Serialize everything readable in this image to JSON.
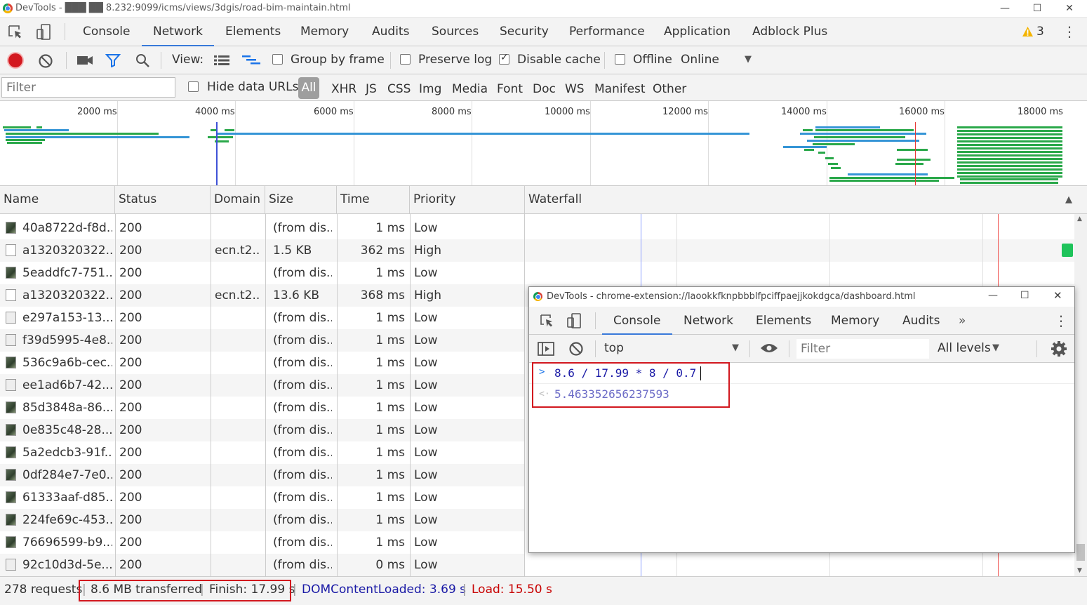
{
  "window": {
    "title": "DevTools - ███ ██ 8.232:9099/icms/views/3dgis/road-bim-maintain.html",
    "minimize": "—",
    "maximize": "☐",
    "close": "✕"
  },
  "tabs": [
    "Console",
    "Network",
    "Elements",
    "Memory",
    "Audits",
    "Sources",
    "Security",
    "Performance",
    "Application",
    "Adblock Plus"
  ],
  "warnings": "3",
  "more_glyph": "⋮",
  "toolbar": {
    "view_label": "View:",
    "group_by_frame": "Group by frame",
    "preserve_log": "Preserve log",
    "disable_cache": "Disable cache",
    "disable_cache_checked": true,
    "offline": "Offline",
    "throttling": "Online",
    "dropdown_glyph": "▼"
  },
  "filterbar": {
    "placeholder": "Filter",
    "hide_data_urls": "Hide data URLs",
    "types": [
      "All",
      "XHR",
      "JS",
      "CSS",
      "Img",
      "Media",
      "Font",
      "Doc",
      "WS",
      "Manifest",
      "Other"
    ]
  },
  "overview": {
    "ticks": [
      "2000 ms",
      "4000 ms",
      "6000 ms",
      "8000 ms",
      "10000 ms",
      "12000 ms",
      "14000 ms",
      "16000 ms",
      "18000 ms"
    ]
  },
  "columns": [
    "Name",
    "Status",
    "Domain",
    "Size",
    "Time",
    "Priority",
    "Waterfall"
  ],
  "sort_glyph": "▲",
  "rows": [
    {
      "name": "40a8722d-f8d...",
      "status": "200",
      "domain": "",
      "size": "(from dis...",
      "time": "1 ms",
      "priority": "Low",
      "icon": "img"
    },
    {
      "name": "a1320320322...",
      "status": "200",
      "domain": "ecn.t2...",
      "size": "1.5 KB",
      "time": "362 ms",
      "priority": "High",
      "icon": "blank"
    },
    {
      "name": "5eaddfc7-751...",
      "status": "200",
      "domain": "",
      "size": "(from dis...",
      "time": "1 ms",
      "priority": "Low",
      "icon": "img"
    },
    {
      "name": "a1320320322...",
      "status": "200",
      "domain": "ecn.t2...",
      "size": "13.6 KB",
      "time": "368 ms",
      "priority": "High",
      "icon": "blank"
    },
    {
      "name": "e297a153-13...",
      "status": "200",
      "domain": "",
      "size": "(from dis...",
      "time": "1 ms",
      "priority": "Low",
      "icon": "light"
    },
    {
      "name": "f39d5995-4e8...",
      "status": "200",
      "domain": "",
      "size": "(from dis...",
      "time": "1 ms",
      "priority": "Low",
      "icon": "light"
    },
    {
      "name": "536c9a6b-cec...",
      "status": "200",
      "domain": "",
      "size": "(from dis...",
      "time": "1 ms",
      "priority": "Low",
      "icon": "img"
    },
    {
      "name": "ee1ad6b7-42...",
      "status": "200",
      "domain": "",
      "size": "(from dis...",
      "time": "1 ms",
      "priority": "Low",
      "icon": "light"
    },
    {
      "name": "85d3848a-86...",
      "status": "200",
      "domain": "",
      "size": "(from dis...",
      "time": "1 ms",
      "priority": "Low",
      "icon": "img"
    },
    {
      "name": "0e835c48-28...",
      "status": "200",
      "domain": "",
      "size": "(from dis...",
      "time": "1 ms",
      "priority": "Low",
      "icon": "img"
    },
    {
      "name": "5a2edcb3-91f...",
      "status": "200",
      "domain": "",
      "size": "(from dis...",
      "time": "1 ms",
      "priority": "Low",
      "icon": "img"
    },
    {
      "name": "0df284e7-7e0...",
      "status": "200",
      "domain": "",
      "size": "(from dis...",
      "time": "1 ms",
      "priority": "Low",
      "icon": "img"
    },
    {
      "name": "61333aaf-d85...",
      "status": "200",
      "domain": "",
      "size": "(from dis...",
      "time": "1 ms",
      "priority": "Low",
      "icon": "img"
    },
    {
      "name": "224fe69c-453...",
      "status": "200",
      "domain": "",
      "size": "(from dis...",
      "time": "1 ms",
      "priority": "Low",
      "icon": "img"
    },
    {
      "name": "76696599-b9...",
      "status": "200",
      "domain": "",
      "size": "(from dis...",
      "time": "1 ms",
      "priority": "Low",
      "icon": "img"
    },
    {
      "name": "92c10d3d-5e...",
      "status": "200",
      "domain": "",
      "size": "(from dis...",
      "time": "0 ms",
      "priority": "Low",
      "icon": "light"
    }
  ],
  "scroll": {
    "up": "▲",
    "down": "▼"
  },
  "popup": {
    "title": "DevTools - chrome-extension://laookkfknpbbblfpciffpaejjkokdgca/dashboard.html",
    "minimize": "—",
    "maximize": "☐",
    "close": "✕",
    "tabs": [
      "Console",
      "Network",
      "Elements",
      "Memory",
      "Audits"
    ],
    "more_tabs": "»",
    "more_glyph": "⋮",
    "context": "top",
    "dropdown_glyph": "▼",
    "filter_placeholder": "Filter",
    "levels": "All levels",
    "prompt_glyph": ">",
    "expression": "8.6 / 17.99 * 8 / 0.7",
    "result_glyph": "<·",
    "result": "5.463352656237593"
  },
  "status": {
    "requests": "278 requests",
    "sep": "|",
    "transferred": "8.6 MB transferred",
    "finish": "Finish: 17.99 s",
    "dcl": "DOMContentLoaded: 3.69 s",
    "load": "Load: 15.50 s"
  },
  "colors": {
    "accent": "#3879d9",
    "record": "#d3181f",
    "dcl": "#1a1aa6",
    "load": "#c80000",
    "highlight_box": "#d2181f",
    "bar_green": "#2aa84a",
    "bar_blue": "#3595d6"
  }
}
